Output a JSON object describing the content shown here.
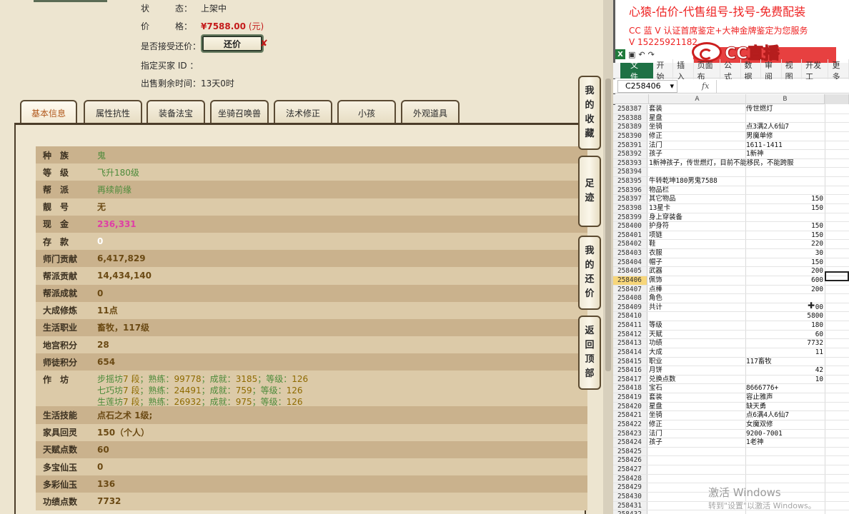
{
  "listing": {
    "status_label": "状　　　态：",
    "status_value": "上架中",
    "price_label": "价　　　格：",
    "price_value": "¥7588.00",
    "price_unit": "(元)",
    "accept_haggle_label": "是否接受还价：",
    "haggle_button": "还价",
    "buyer_id_label": "指定买家 ID ：",
    "time_left_label": "出售剩余时间：",
    "time_left_value": "13天0时"
  },
  "tabs": [
    "基本信息",
    "属性抗性",
    "装备法宝",
    "坐骑召唤兽",
    "法术修正",
    "小孩",
    "外观道具"
  ],
  "side_buttons": [
    {
      "name": "my-favorites",
      "chars": [
        "我",
        "的",
        "收",
        "藏"
      ]
    },
    {
      "name": "footprints",
      "chars": [
        "足",
        "迹"
      ]
    },
    {
      "name": "my-offers",
      "chars": [
        "我",
        "的",
        "还",
        "价"
      ]
    },
    {
      "name": "back-to-top",
      "chars": [
        "返",
        "回",
        "顶",
        "部"
      ]
    }
  ],
  "info_rows": [
    {
      "k": "种　族",
      "v": "鬼",
      "style": "green"
    },
    {
      "k": "等　级",
      "v": "飞升180级",
      "style": "green"
    },
    {
      "k": "帮　派",
      "v": "再续前缘",
      "style": "green"
    },
    {
      "k": "靓　号",
      "v": "无",
      "style": "yellow"
    },
    {
      "k": "现　金",
      "v": "236,331",
      "style": "pink"
    },
    {
      "k": "存　款",
      "v": "0",
      "style": "white"
    },
    {
      "k": "师门贡献",
      "v": "6,417,829",
      "style": "yellow"
    },
    {
      "k": "帮派贡献",
      "v": "14,434,140",
      "style": "yellow"
    },
    {
      "k": "帮派成就",
      "v": "0",
      "style": "yellow"
    },
    {
      "k": "大成修炼",
      "v": "11点",
      "style": "yellow"
    },
    {
      "k": "生活职业",
      "v": "畜牧，117级",
      "style": "yellow"
    },
    {
      "k": "地宫积分",
      "v": "28",
      "style": "yellow"
    },
    {
      "k": "师徒积分",
      "v": "654",
      "style": "yellow"
    }
  ],
  "workshop": {
    "k": "作　坊",
    "lines": [
      {
        "name": "步摇坊",
        "level": "7 段",
        "a": "；熟练：",
        "skill": "99778",
        "b": "；成就：",
        "ach": "3185",
        "c": "；等级：",
        "lv": "126"
      },
      {
        "name": "七巧坊",
        "level": "7 段",
        "a": "；熟练：",
        "skill": "24491",
        "b": "；成就：",
        "ach": "759",
        "c": "；等级：",
        "lv": "126"
      },
      {
        "name": "生莲坊",
        "level": "7 段",
        "a": "；熟练：",
        "skill": "26932",
        "b": "；成就：",
        "ach": "975",
        "c": "；等级：",
        "lv": "126"
      }
    ]
  },
  "info_rows_2": [
    {
      "k": "生活技能",
      "v": "点石之术 1级;",
      "style": "yellow"
    },
    {
      "k": "家具回灵",
      "v": "150（个人）",
      "style": "yellow"
    },
    {
      "k": "天赋点数",
      "v": "60",
      "style": "yellow"
    },
    {
      "k": "多宝仙玉",
      "v": "0",
      "style": "yellow"
    },
    {
      "k": "多彩仙玉",
      "v": "136",
      "style": "yellow"
    },
    {
      "k": "功绩点数",
      "v": "7732",
      "style": "yellow"
    }
  ],
  "ads": {
    "line1": "心猿-估价-代售组号-找号-免费配装",
    "line2": "CC 蓝 V 认证首席鉴定+大神金牌鉴定为您服务",
    "line3": "V 15225921182",
    "logo_text": "CC直播"
  },
  "excel": {
    "file_tab": "文件",
    "ribbon_tabs": [
      "开始",
      "插入",
      "页面布",
      "公式",
      "数据",
      "审阅",
      "视图",
      "开发工",
      "更多"
    ],
    "name_box": "C258406",
    "fx": "fx",
    "col_a": "A",
    "col_b": "B",
    "selected_row": "258406",
    "rows": [
      {
        "n": "258387",
        "a": "套装",
        "b": "传世燃灯"
      },
      {
        "n": "258388",
        "a": "星盘",
        "b": ""
      },
      {
        "n": "258389",
        "a": "坐骑",
        "b": "点3满2人6仙7"
      },
      {
        "n": "258390",
        "a": "修正",
        "b": "男魔单修"
      },
      {
        "n": "258391",
        "a": "法门",
        "b": "1611-1411"
      },
      {
        "n": "258392",
        "a": "孩子",
        "b": "1新神"
      },
      {
        "n": "258393",
        "a": "1新神孩子，传世燃灯，目前不能移民，不能跨服",
        "b": ""
      },
      {
        "n": "258394",
        "a": "",
        "b": ""
      },
      {
        "n": "258395",
        "a": "牛转乾坤180男鬼7588",
        "b": ""
      },
      {
        "n": "258396",
        "a": "物品栏",
        "b": ""
      },
      {
        "n": "258397",
        "a": "其它物品",
        "b": "150",
        "num": true
      },
      {
        "n": "258398",
        "a": "13星卡",
        "b": "150",
        "num": true
      },
      {
        "n": "258399",
        "a": "身上穿装备",
        "b": ""
      },
      {
        "n": "258400",
        "a": "护身符",
        "b": "150",
        "num": true
      },
      {
        "n": "258401",
        "a": "项链",
        "b": "150",
        "num": true
      },
      {
        "n": "258402",
        "a": "鞋",
        "b": "220",
        "num": true
      },
      {
        "n": "258403",
        "a": "衣服",
        "b": "30",
        "num": true
      },
      {
        "n": "258404",
        "a": "帽子",
        "b": "150",
        "num": true
      },
      {
        "n": "258405",
        "a": "武器",
        "b": "200",
        "num": true
      },
      {
        "n": "258406",
        "a": "佩饰",
        "b": "600",
        "num": true
      },
      {
        "n": "258407",
        "a": "点棒",
        "b": "200",
        "num": true
      },
      {
        "n": "258408",
        "a": "角色",
        "b": ""
      },
      {
        "n": "258409",
        "a": "共计",
        "b": "00",
        "num": true
      },
      {
        "n": "258410",
        "a": "",
        "b": "5800",
        "num": true
      },
      {
        "n": "258411",
        "a": "等级",
        "b": "180",
        "num": true
      },
      {
        "n": "258412",
        "a": "天赋",
        "b": "60",
        "num": true
      },
      {
        "n": "258413",
        "a": "功绩",
        "b": "7732",
        "num": true
      },
      {
        "n": "258414",
        "a": "大成",
        "b": "11",
        "num": true
      },
      {
        "n": "258415",
        "a": "职业",
        "b": "117畜牧"
      },
      {
        "n": "258416",
        "a": "月饼",
        "b": "42",
        "num": true
      },
      {
        "n": "258417",
        "a": "兑换点数",
        "b": "10",
        "num": true
      },
      {
        "n": "258418",
        "a": "宝石",
        "b": "8666776+"
      },
      {
        "n": "258419",
        "a": "套装",
        "b": "容止雅声"
      },
      {
        "n": "258420",
        "a": "星盘",
        "b": "缺天勇"
      },
      {
        "n": "258421",
        "a": "坐骑",
        "b": "点6满4人6仙7"
      },
      {
        "n": "258422",
        "a": "修正",
        "b": "女魔双修"
      },
      {
        "n": "258423",
        "a": "法门",
        "b": "9200-7001"
      },
      {
        "n": "258424",
        "a": "孩子",
        "b": "1老神"
      },
      {
        "n": "258425",
        "a": "",
        "b": ""
      },
      {
        "n": "258426",
        "a": "",
        "b": ""
      },
      {
        "n": "258427",
        "a": "",
        "b": ""
      },
      {
        "n": "258428",
        "a": "",
        "b": ""
      },
      {
        "n": "258429",
        "a": "",
        "b": ""
      },
      {
        "n": "258430",
        "a": "",
        "b": ""
      },
      {
        "n": "258431",
        "a": "",
        "b": ""
      },
      {
        "n": "258432",
        "a": "",
        "b": ""
      }
    ]
  },
  "watermark": {
    "title": "激活 Windows",
    "sub": "转到\"设置\"以激活 Windows。"
  },
  "colors": {
    "accent_red": "#c41b1b",
    "excel_green": "#1e7145"
  }
}
